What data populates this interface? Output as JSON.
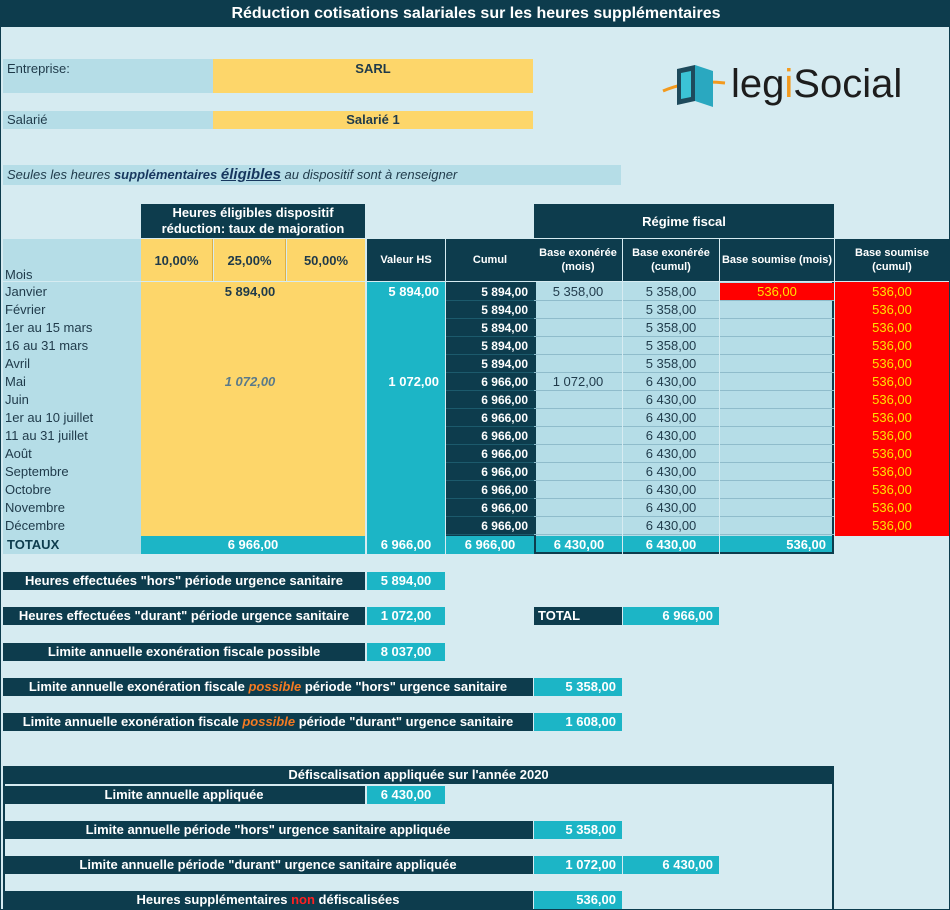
{
  "title": "Réduction cotisations salariales sur les heures supplémentaires",
  "entreprise": {
    "label": "Entreprise:",
    "value": "SARL"
  },
  "salarie": {
    "label": "Salarié",
    "value": "Salarié 1"
  },
  "logo": {
    "part1": "legi",
    "part2": "Social",
    "icon": "legisocial-cube-icon",
    "accent": "#f39a1e"
  },
  "note": {
    "prefix": "Seules les heures ",
    "bold1": "supplémentaires",
    "bold2": "éligibles",
    "suffix": " au dispositif sont à renseigner"
  },
  "headers": {
    "eligible_title": "Heures éligibles dispositif réduction: taux de majoration",
    "rate10": "10,00%",
    "rate25": "25,00%",
    "rate50": "50,00%",
    "mois": "Mois",
    "valeur_hs": "Valeur HS",
    "cumul": "Cumul",
    "regime_fiscal": "Régime fiscal",
    "base_exo_mois": "Base exonérée (mois)",
    "base_exo_cumul": "Base exonérée (cumul)",
    "base_soum_mois": "Base soumise (mois)",
    "base_soum_cumul": "Base soumise (cumul)"
  },
  "table": {
    "columns": [
      "Mois",
      "10,00%",
      "25,00%",
      "50,00%",
      "Valeur HS",
      "Cumul",
      "Base exonérée (mois)",
      "Base exonérée (cumul)",
      "Base soumise (mois)",
      "Base soumise (cumul)"
    ],
    "rows": [
      {
        "mois": "Janvier",
        "r25": "5 894,00",
        "r25_italic": "",
        "valeur": "5 894,00",
        "cumul": "5 894,00",
        "exo_mois": "5 358,00",
        "exo_cumul": "5 358,00",
        "soum_mois": "536,00",
        "soum_cumul": "536,00"
      },
      {
        "mois": "Février",
        "r25": "",
        "r25_italic": "",
        "valeur": "",
        "cumul": "5 894,00",
        "exo_mois": "",
        "exo_cumul": "5 358,00",
        "soum_mois": "",
        "soum_cumul": "536,00"
      },
      {
        "mois": "1er au 15 mars",
        "r25": "",
        "r25_italic": "",
        "valeur": "",
        "cumul": "5 894,00",
        "exo_mois": "",
        "exo_cumul": "5 358,00",
        "soum_mois": "",
        "soum_cumul": "536,00"
      },
      {
        "mois": "16 au 31 mars",
        "r25": "",
        "r25_italic": "",
        "valeur": "",
        "cumul": "5 894,00",
        "exo_mois": "",
        "exo_cumul": "5 358,00",
        "soum_mois": "",
        "soum_cumul": "536,00"
      },
      {
        "mois": "Avril",
        "r25": "",
        "r25_italic": "",
        "valeur": "",
        "cumul": "5 894,00",
        "exo_mois": "",
        "exo_cumul": "5 358,00",
        "soum_mois": "",
        "soum_cumul": "536,00"
      },
      {
        "mois": "Mai",
        "r25": "",
        "r25_italic": "1 072,00",
        "valeur": "1 072,00",
        "cumul": "6 966,00",
        "exo_mois": "1 072,00",
        "exo_cumul": "6 430,00",
        "soum_mois": "",
        "soum_cumul": "536,00"
      },
      {
        "mois": "Juin",
        "r25": "",
        "r25_italic": "",
        "valeur": "",
        "cumul": "6 966,00",
        "exo_mois": "",
        "exo_cumul": "6 430,00",
        "soum_mois": "",
        "soum_cumul": "536,00"
      },
      {
        "mois": "1er au 10 juillet",
        "r25": "",
        "r25_italic": "",
        "valeur": "",
        "cumul": "6 966,00",
        "exo_mois": "",
        "exo_cumul": "6 430,00",
        "soum_mois": "",
        "soum_cumul": "536,00"
      },
      {
        "mois": "11 au 31 juillet",
        "r25": "",
        "r25_italic": "",
        "valeur": "",
        "cumul": "6 966,00",
        "exo_mois": "",
        "exo_cumul": "6 430,00",
        "soum_mois": "",
        "soum_cumul": "536,00"
      },
      {
        "mois": "Août",
        "r25": "",
        "r25_italic": "",
        "valeur": "",
        "cumul": "6 966,00",
        "exo_mois": "",
        "exo_cumul": "6 430,00",
        "soum_mois": "",
        "soum_cumul": "536,00"
      },
      {
        "mois": "Septembre",
        "r25": "",
        "r25_italic": "",
        "valeur": "",
        "cumul": "6 966,00",
        "exo_mois": "",
        "exo_cumul": "6 430,00",
        "soum_mois": "",
        "soum_cumul": "536,00"
      },
      {
        "mois": "Octobre",
        "r25": "",
        "r25_italic": "",
        "valeur": "",
        "cumul": "6 966,00",
        "exo_mois": "",
        "exo_cumul": "6 430,00",
        "soum_mois": "",
        "soum_cumul": "536,00"
      },
      {
        "mois": "Novembre",
        "r25": "",
        "r25_italic": "",
        "valeur": "",
        "cumul": "6 966,00",
        "exo_mois": "",
        "exo_cumul": "6 430,00",
        "soum_mois": "",
        "soum_cumul": "536,00"
      },
      {
        "mois": "Décembre",
        "r25": "",
        "r25_italic": "",
        "valeur": "",
        "cumul": "6 966,00",
        "exo_mois": "",
        "exo_cumul": "6 430,00",
        "soum_mois": "",
        "soum_cumul": "536,00"
      }
    ],
    "totals": {
      "label": "TOTAUX",
      "hs": "6 966,00",
      "valeur": "6 966,00",
      "cumul": "6 966,00",
      "exo_mois": "6 430,00",
      "exo_cumul": "6 430,00",
      "soum_mois": "536,00"
    }
  },
  "summary": {
    "hors_label": "Heures effectuées \"hors\" période urgence sanitaire",
    "hors_value": "5 894,00",
    "durant_label": "Heures effectuées \"durant\" période urgence sanitaire",
    "durant_value": "1 072,00",
    "total_label": "TOTAL",
    "total_value": "6 966,00",
    "limite_label": "Limite annuelle exonération fiscale possible",
    "limite_value": "8 037,00",
    "limite_hors_pre": "Limite annuelle exonération fiscale ",
    "limite_hors_mid": "possible",
    "limite_hors_post": " période \"hors\" urgence sanitaire",
    "limite_hors_value": "5 358,00",
    "limite_durant_pre": "Limite annuelle exonération fiscale ",
    "limite_durant_mid": "possible",
    "limite_durant_post": " période \"durant\" urgence sanitaire",
    "limite_durant_value": "1 608,00"
  },
  "defisc": {
    "title": "Défiscalisation appliquée sur l'année 2020",
    "appliquee_label": "Limite annuelle appliquée",
    "appliquee_value": "6 430,00",
    "hors_label": "Limite annuelle période \"hors\" urgence sanitaire appliquée",
    "hors_value": "5 358,00",
    "durant_label": "Limite annuelle période \"durant\" urgence sanitaire appliquée",
    "durant_value1": "1 072,00",
    "durant_value2": "6 430,00",
    "non_pre": "Heures supplémentaires ",
    "non_mid": "non",
    "non_post": " défiscalisées",
    "non_value": "536,00"
  },
  "colors": {
    "navy": "#0d3c4d",
    "teal": "#1cb5c6",
    "yellow": "#fdd66a",
    "light": "#b5dde7",
    "red": "#ff0000"
  }
}
